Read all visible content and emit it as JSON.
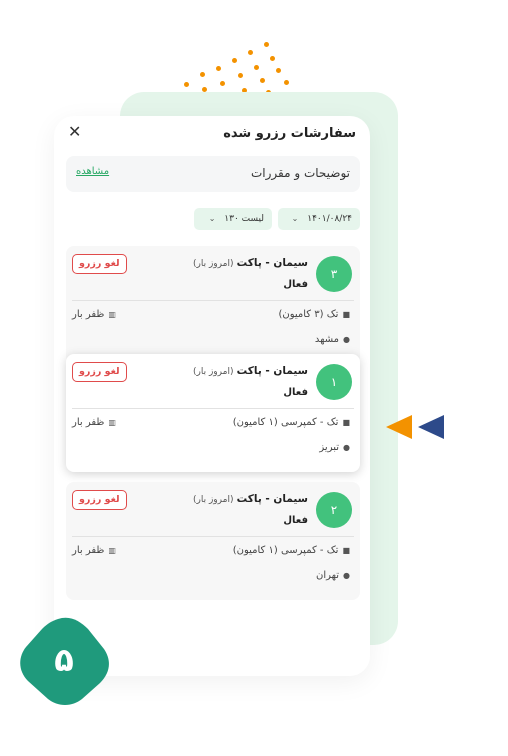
{
  "header": {
    "title": "سفارشات رزرو شده",
    "close_icon": "close-icon"
  },
  "description": {
    "label": "توضیحات و مقررات",
    "link": "مشاهده"
  },
  "filters": {
    "date": "۱۴۰۱/۰۸/۲۴",
    "list": "لیست ۱۳۰"
  },
  "orders": [
    {
      "number": "۳",
      "company": "سیمان - پاکت",
      "tag": "(امروز بار)",
      "status": "فعال",
      "cancel_label": "لغو رزرو",
      "truck": "تک (۳ کامیون)",
      "city": "مشهد",
      "owner": "ظفر بار"
    },
    {
      "number": "۱",
      "company": "سیمان - پاکت",
      "tag": "(امروز بار)",
      "status": "فعال",
      "cancel_label": "لغو رزرو",
      "truck": "تک - کمپرسی (۱ کامیون)",
      "city": "تبریز",
      "owner": "ظفر بار"
    },
    {
      "number": "۲",
      "company": "سیمان - پاکت",
      "tag": "(امروز بار)",
      "status": "فعال",
      "cancel_label": "لغو رزرو",
      "truck": "تک - کمپرسی (۱ کامیون)",
      "city": "تهران",
      "owner": "ظفر بار"
    }
  ],
  "step_badge": {
    "number": "۵"
  },
  "colors": {
    "accent": "#42c27d",
    "link": "#27a864",
    "danger": "#e04b4b",
    "dots": "#f39200",
    "badge": "#1f9a7c",
    "arrow_orange": "#f39200",
    "arrow_navy": "#2d4a8a",
    "panel_bg": "#e4f5ea"
  }
}
